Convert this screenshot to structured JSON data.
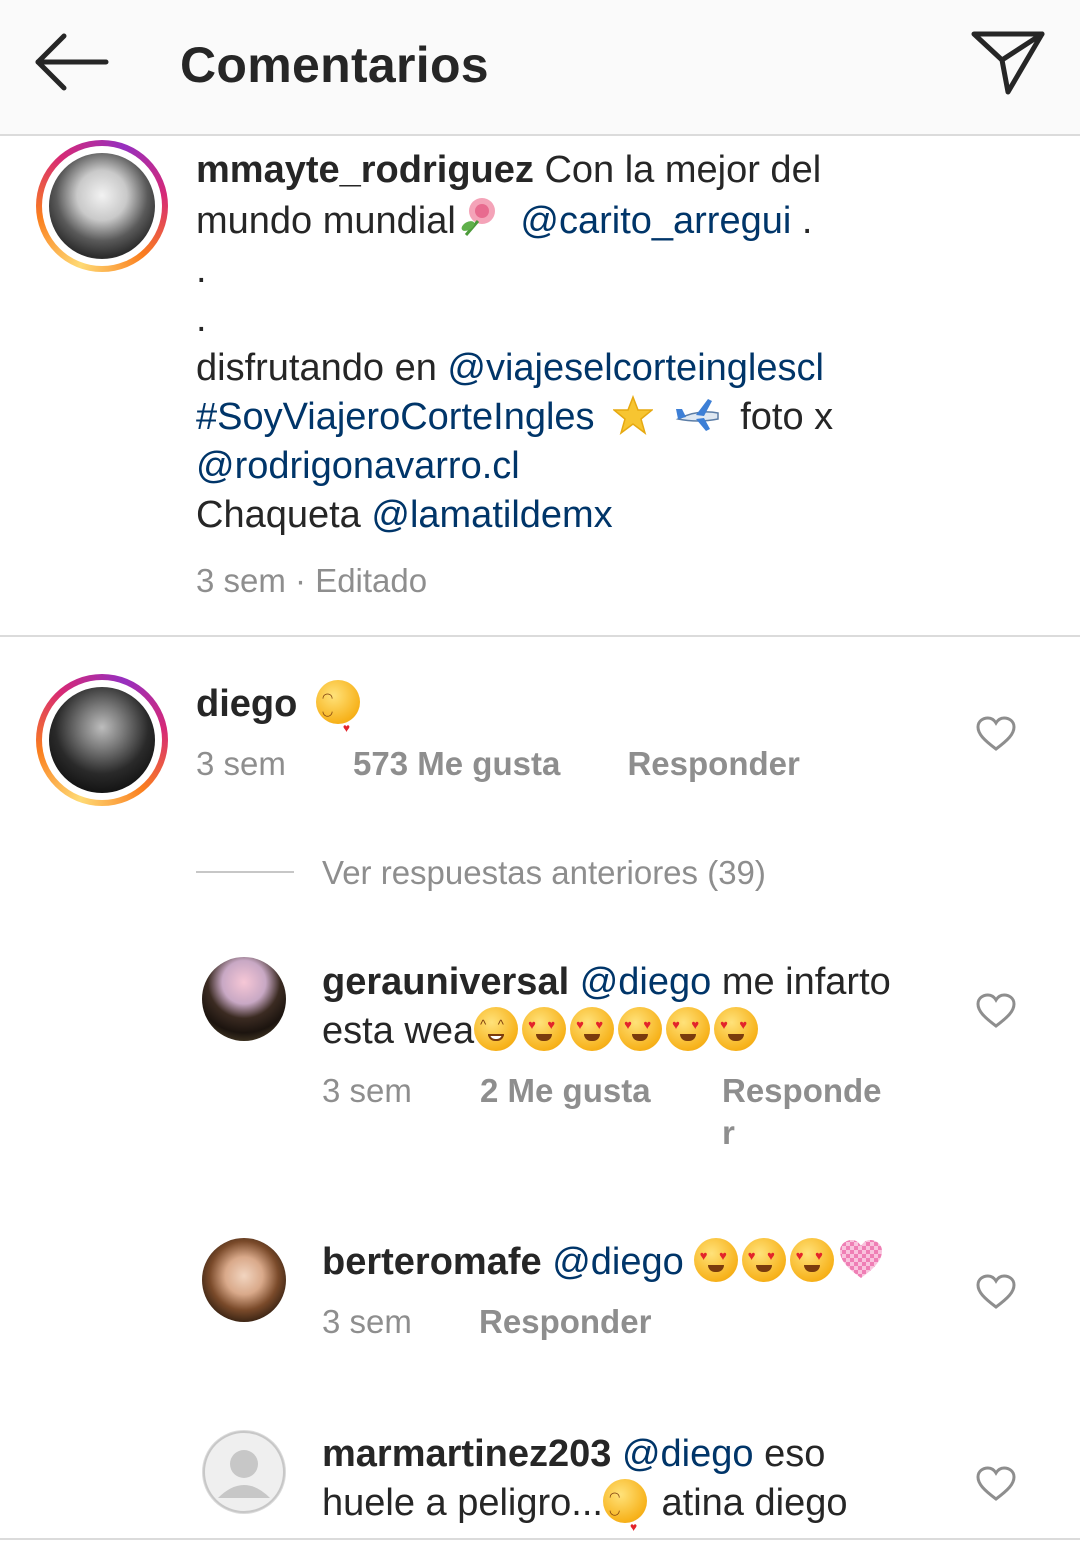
{
  "header": {
    "title": "Comentarios"
  },
  "post": {
    "username": "mmayte_rodriguez",
    "line1_text": "Con la mejor del",
    "line2_text": "mundo mundial",
    "line2_mention": "@carito_arregui",
    "line2_end": " .",
    "dot1": ".",
    "dot2": ".",
    "line5_text": "disfrutando en ",
    "line5_mention": "@viajeselcorteinglescl",
    "line6_hashtag": "#SoyViajeroCorteIngles",
    "line6_end": "foto x",
    "line7_mention": "@rodrigonavarro.cl",
    "line8_text": "Chaqueta ",
    "line8_mention": "@lamatildemx",
    "meta": "3 sem · Editado"
  },
  "comments": [
    {
      "username": "diego",
      "time": "3 sem",
      "likes": "573 Me gusta",
      "reply": "Responder",
      "view_replies": "Ver respuestas anteriores (39)"
    },
    {
      "username": "gerauniversal",
      "mention": "@diego",
      "text1": " me infarto",
      "text2": "esta wea",
      "time": "3 sem",
      "likes": "2 Me gusta",
      "reply_a": "Responde",
      "reply_b": "r"
    },
    {
      "username": "berteromafe",
      "mention": "@diego",
      "time": "3 sem",
      "reply": "Responder"
    },
    {
      "username": "marmartinez203",
      "mention": "@diego",
      "text1": " eso",
      "text2": "huele a peligro...",
      "text3": " atina diego"
    }
  ],
  "colors": {
    "mention": "#003569",
    "meta": "#8e8e8e",
    "text": "#262626",
    "divider": "#dbdbdb"
  }
}
